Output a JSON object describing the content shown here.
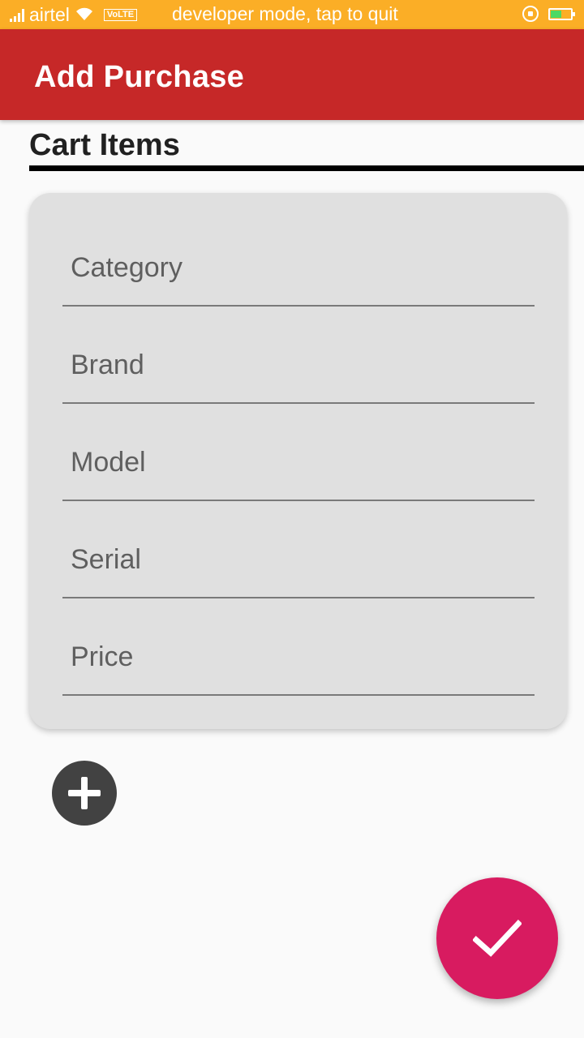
{
  "status_bar": {
    "carrier": "airtel",
    "network_badge": "VoLTE",
    "notice": "developer mode, tap to quit",
    "icons": [
      "signal-icon",
      "wifi-icon",
      "rotation-lock-icon",
      "battery-icon"
    ]
  },
  "app_bar": {
    "title": "Add Purchase",
    "color": "#c62828"
  },
  "cart": {
    "section_title": "Cart Items",
    "fields": [
      {
        "placeholder": "Category",
        "value": ""
      },
      {
        "placeholder": "Brand",
        "value": ""
      },
      {
        "placeholder": "Model",
        "value": ""
      },
      {
        "placeholder": "Serial",
        "value": ""
      },
      {
        "placeholder": "Price",
        "value": ""
      }
    ]
  },
  "actions": {
    "add_item_icon": "plus-icon",
    "submit_icon": "check-icon",
    "submit_color": "#d81b60"
  }
}
